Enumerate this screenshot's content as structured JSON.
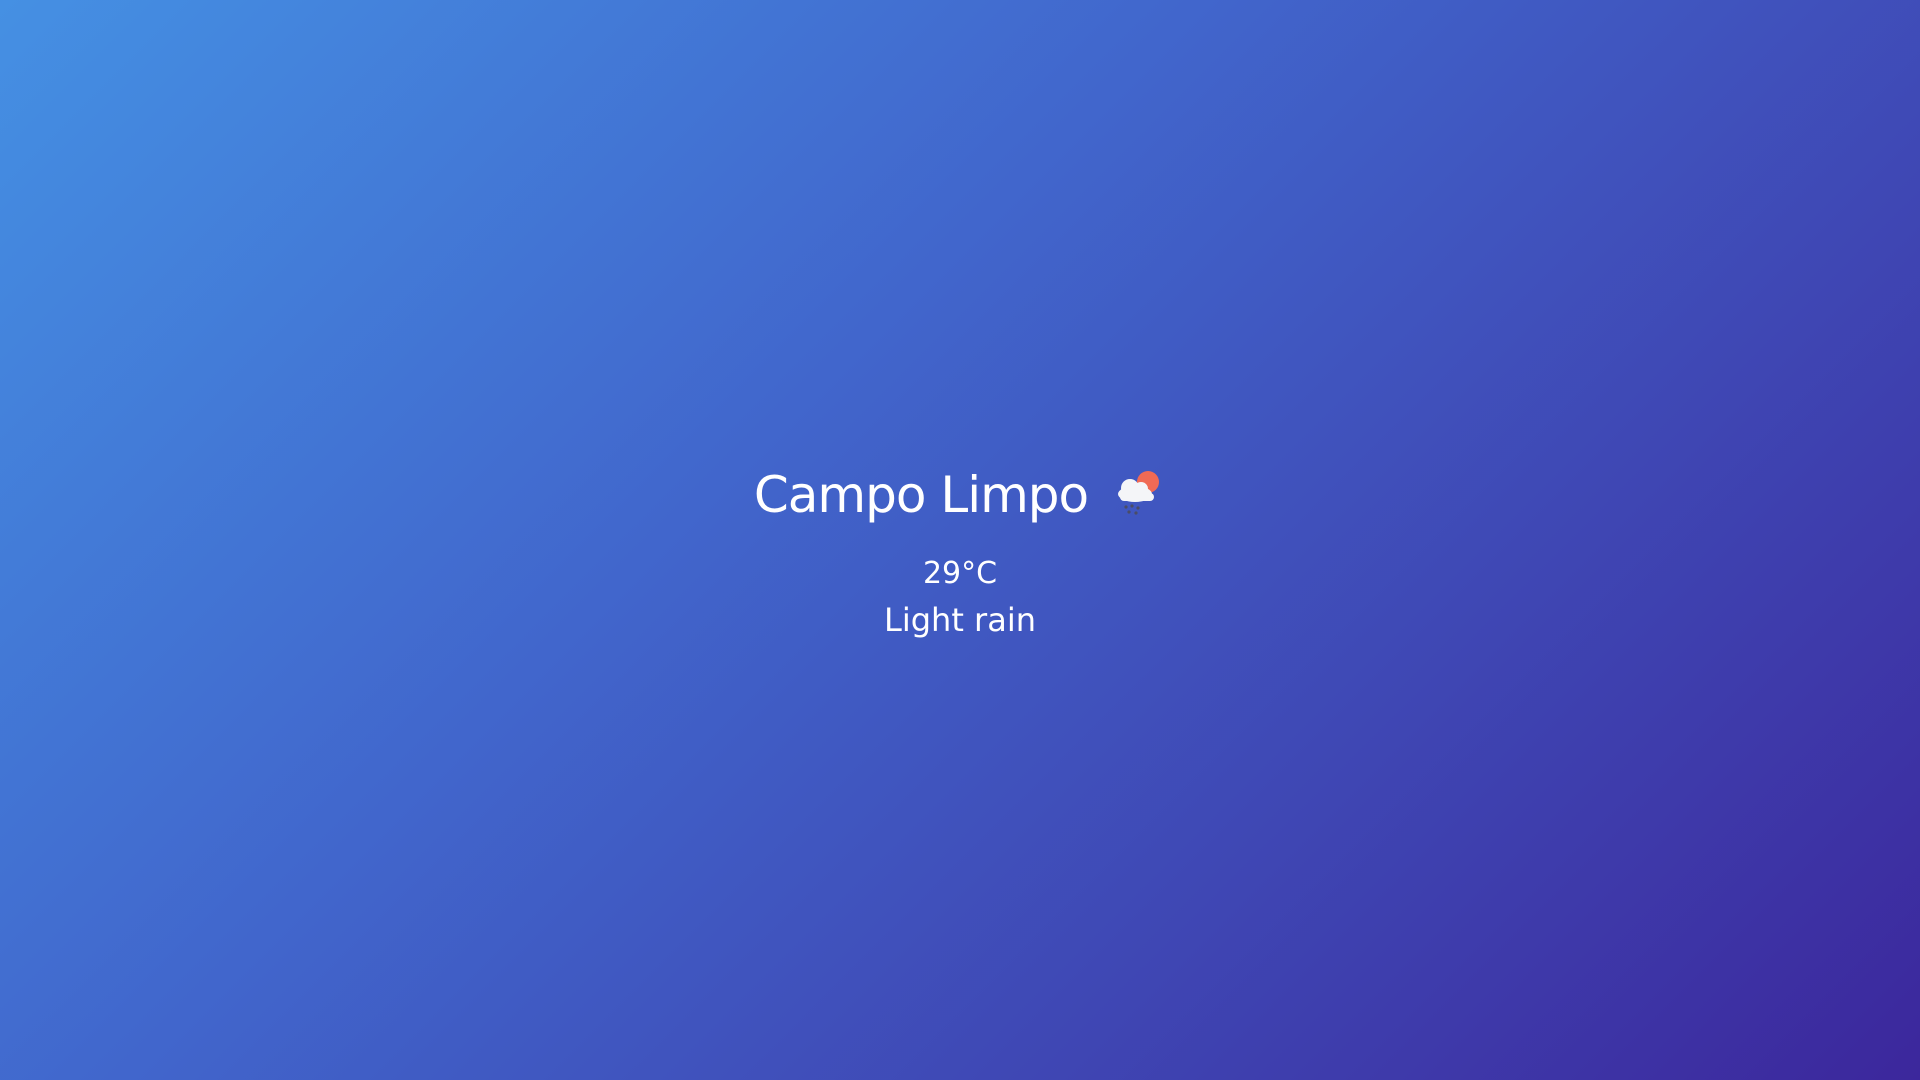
{
  "weather": {
    "city": "Campo Limpo",
    "temperature": "29°C",
    "description": "Light rain",
    "icon": "light-rain-cloud-sun-icon"
  },
  "colors": {
    "gradient_start": "#4590e3",
    "gradient_end": "#3c279c",
    "text": "#ffffff",
    "sun": "#f06a55",
    "cloud": "#f4f5f8",
    "rain": "#4a4d66"
  }
}
